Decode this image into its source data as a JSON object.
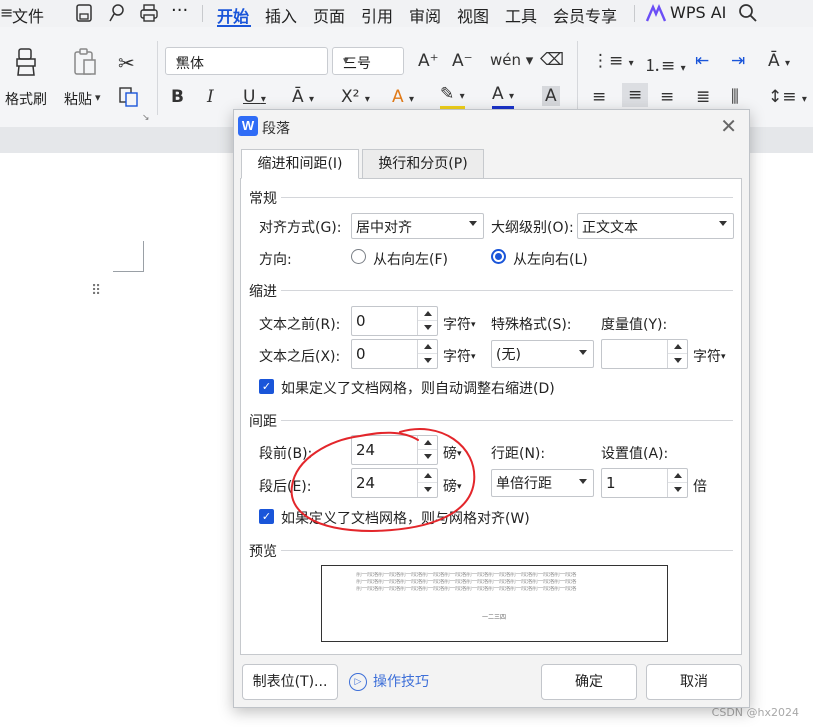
{
  "menubar": {
    "file": "文件",
    "tabs": [
      "开始",
      "插入",
      "页面",
      "引用",
      "审阅",
      "视图",
      "工具",
      "会员专享"
    ],
    "active_tab": "开始",
    "wps_ai": "WPS AI",
    "accent": "#1a55d9"
  },
  "ribbon": {
    "format_painter": "格式刷",
    "paste": "粘贴",
    "font_name": "黑体",
    "font_size": "三号"
  },
  "dialog": {
    "title": "段落",
    "tab_indent": "缩进和间距(I)",
    "tab_break": "换行和分页(P)",
    "general": {
      "section": "常规",
      "align_label": "对齐方式(G):",
      "align_value": "居中对齐",
      "outline_label": "大纲级别(O):",
      "outline_value": "正文文本",
      "direction_label": "方向:",
      "rtl": "从右向左(F)",
      "ltr": "从左向右(L)"
    },
    "indent": {
      "section": "缩进",
      "before_label": "文本之前(R):",
      "before_value": "0",
      "before_unit": "字符",
      "after_label": "文本之后(X):",
      "after_value": "0",
      "after_unit": "字符",
      "special_label": "特殊格式(S):",
      "special_value": "(无)",
      "measure_label": "度量值(Y):",
      "measure_value": "",
      "measure_unit": "字符",
      "grid_check": "如果定义了文档网格，则自动调整右缩进(D)"
    },
    "spacing": {
      "section": "间距",
      "before_label": "段前(B):",
      "before_value": "24",
      "before_unit": "磅",
      "after_label": "段后(E):",
      "after_value": "24",
      "after_unit": "磅",
      "line_label": "行距(N):",
      "line_value": "单倍行距",
      "setting_label": "设置值(A):",
      "setting_value": "1",
      "setting_unit": "倍",
      "grid_check": "如果定义了文档网格，则与网格对齐(W)"
    },
    "preview": {
      "section": "预览",
      "prev_text": "前一段落前一段落前一段落前一段落前一段落前一段落前一段落前一段落前一段落前一段落",
      "current_text": "一二三四"
    },
    "buttons": {
      "tabs": "制表位(T)...",
      "tips": "操作技巧",
      "ok": "确定",
      "cancel": "取消"
    }
  },
  "watermark": "CSDN @hx2024"
}
